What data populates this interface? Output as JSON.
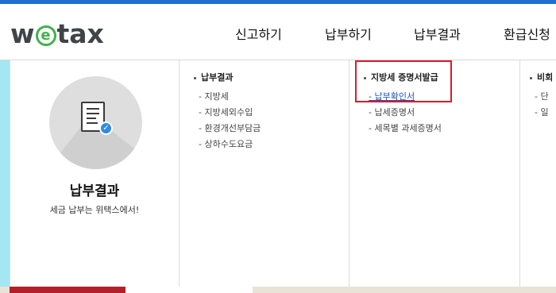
{
  "logo": {
    "before": "w",
    "e": "e",
    "after": "tax"
  },
  "nav": {
    "items": [
      {
        "label": "신고하기"
      },
      {
        "label": "납부하기"
      },
      {
        "label": "납부결과"
      },
      {
        "label": "환급신청"
      }
    ]
  },
  "feature": {
    "icon": "document-check-icon",
    "title": "납부결과",
    "subtitle": "세금 납부는 위택스에서!"
  },
  "columns": [
    {
      "heading": "납부결과",
      "items": [
        "- 지방세",
        "- 지방세외수입",
        "- 환경개선부담금",
        "- 상하수도요금"
      ]
    },
    {
      "heading": "지방세 증명서발급",
      "items": [
        "- 납부확인서",
        "- 납세증명서",
        "- 세목별 과세증명서"
      ],
      "active_index": 0
    },
    {
      "heading": "비회",
      "items": [
        "- 단",
        "- 일"
      ]
    }
  ],
  "colors": {
    "accent": "#1e6fd1",
    "brand_green": "#41b24b",
    "highlight": "#e0182b",
    "link": "#1a53b8"
  }
}
